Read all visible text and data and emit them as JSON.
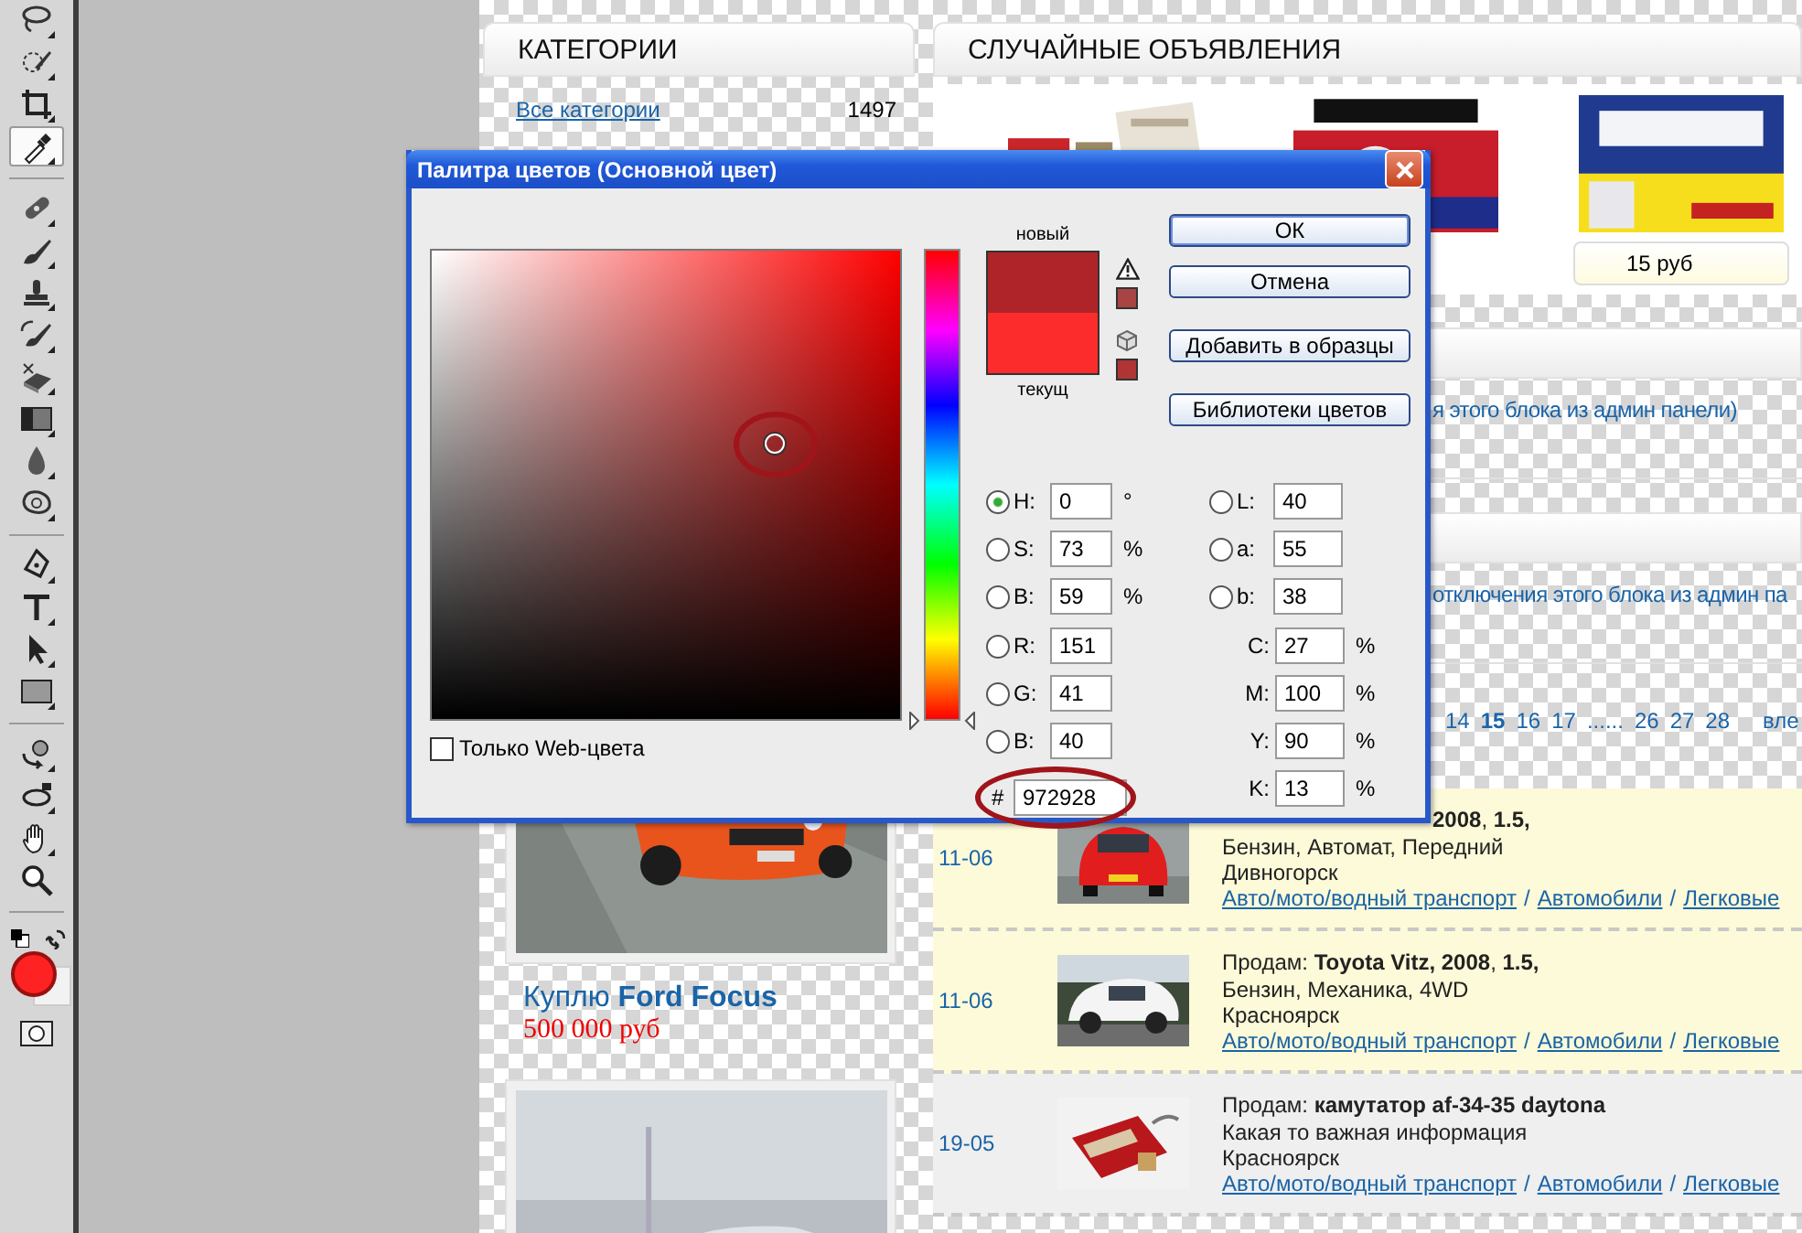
{
  "toolbar": {
    "tool_groups": [
      {
        "tools": [
          {
            "selected": false
          },
          {
            "selected": false
          },
          {
            "selected": false
          },
          {
            "selected": true
          }
        ]
      },
      {
        "tools": [
          {
            "selected": false
          },
          {
            "selected": false
          },
          {
            "selected": false
          },
          {
            "selected": false
          },
          {
            "selected": false
          },
          {
            "selected": false
          },
          {
            "selected": false
          },
          {
            "selected": false
          }
        ]
      },
      {
        "tools": [
          {
            "selected": false
          },
          {
            "selected": false
          },
          {
            "selected": false
          },
          {
            "selected": false
          }
        ]
      },
      {
        "tools": [
          {
            "selected": false
          },
          {
            "selected": false
          },
          {
            "selected": false
          },
          {
            "selected": false
          }
        ]
      }
    ]
  },
  "page": {
    "categories": {
      "title": "КАТЕГОРИИ",
      "items": [
        {
          "label": "Все категории",
          "count": "1497"
        }
      ]
    },
    "featured": [
      {
        "kind": "picture",
        "title": "Куплю **Ford Focus**",
        "price": "500 000 руб"
      },
      {
        "kind": "picture"
      }
    ],
    "random_ads": {
      "title": "СЛУЧАЙНЫЕ ОБЪЯВЛЕНИЯ",
      "tiles": [
        {
          "kind": "picture"
        },
        {
          "kind": "picture"
        },
        {
          "kind": "picture",
          "price": "15 руб"
        }
      ]
    },
    "blocks": [
      {
        "note": "я этого блока из админ панели)"
      },
      {
        "note": "отключения этого блока из админ па"
      }
    ],
    "pagination": {
      "pages": [
        {
          "label": "14",
          "selected": false
        },
        {
          "label": "15",
          "selected": true
        },
        {
          "label": "16",
          "selected": false
        },
        {
          "label": "17",
          "selected": false
        },
        {
          "label": "......",
          "selected": false
        },
        {
          "label": "26",
          "selected": false
        },
        {
          "label": "27",
          "selected": false
        },
        {
          "label": "28",
          "selected": false
        }
      ],
      "next": "вле"
    },
    "listings": [
      {
        "date": "11-06",
        "highlighted": true,
        "partial": true,
        "title": "**2008**, **1.5,**",
        "details": [
          "Бензин, Автомат, Передний",
          "Дивногорск"
        ],
        "path": [
          "Авто/мото/водный транспорт",
          "Автомобили",
          "Легковые"
        ],
        "separator": "/"
      },
      {
        "date": "11-06",
        "highlighted": true,
        "partial": false,
        "title": "Продам: **Toyota Vitz, 2008**, **1.5,**",
        "details": [
          "Бензин, Механика, 4WD",
          "Красноярск"
        ],
        "path": [
          "Авто/мото/водный транспорт",
          "Автомобили",
          "Легковые"
        ],
        "separator": "/"
      },
      {
        "date": "19-05",
        "highlighted": false,
        "partial": false,
        "title": "Продам: **камутатор af-34-35 daytona**",
        "details": [
          "Какая то важная информация",
          "Красноярск"
        ],
        "path": [
          "Авто/мото/водный транспорт",
          "Автомобили",
          "Легковые"
        ],
        "separator": "/"
      }
    ]
  },
  "dialog": {
    "title": "Палитра цветов (Основной цвет)",
    "hue_slider": {
      "level": 0
    },
    "swatches": [
      {
        "label": "новый",
        "color": "#ae2428"
      },
      {
        "label": "текущ",
        "color": "#fc2c2c"
      }
    ],
    "buttons": [
      {
        "label": "ОК",
        "default": true
      },
      {
        "label": "Отмена",
        "default": false
      },
      {
        "label": "Добавить в образцы",
        "default": false
      },
      {
        "label": "Библиотеки цветов",
        "default": false
      }
    ],
    "fields_left": [
      {
        "kind": "radio",
        "label": "H:",
        "value": "0",
        "unit": "°",
        "selected": true
      },
      {
        "kind": "radio",
        "label": "S:",
        "value": "73",
        "unit": "%",
        "selected": false
      },
      {
        "kind": "radio",
        "label": "B:",
        "value": "59",
        "unit": "%",
        "selected": false
      },
      {
        "kind": "radio",
        "label": "R:",
        "value": "151",
        "selected": false
      },
      {
        "kind": "radio",
        "label": "G:",
        "value": "41",
        "selected": false
      },
      {
        "kind": "radio",
        "label": "B:",
        "value": "40",
        "selected": false
      }
    ],
    "fields_right": [
      {
        "kind": "radio",
        "label": "L:",
        "value": "40",
        "selected": false
      },
      {
        "kind": "radio",
        "label": "a:",
        "value": "55",
        "selected": false
      },
      {
        "kind": "radio",
        "label": "b:",
        "value": "38",
        "selected": false
      },
      {
        "kind": "plain",
        "label": "C:",
        "value": "27",
        "unit": "%"
      },
      {
        "kind": "plain",
        "label": "M:",
        "value": "100",
        "unit": "%"
      },
      {
        "kind": "plain",
        "label": "Y:",
        "value": "90",
        "unit": "%"
      },
      {
        "kind": "plain",
        "label": "K:",
        "value": "13",
        "unit": "%"
      }
    ],
    "hex": {
      "label": "#",
      "value": "972928"
    },
    "web_only": {
      "label": "Только Web-цвета",
      "checked": false
    }
  }
}
